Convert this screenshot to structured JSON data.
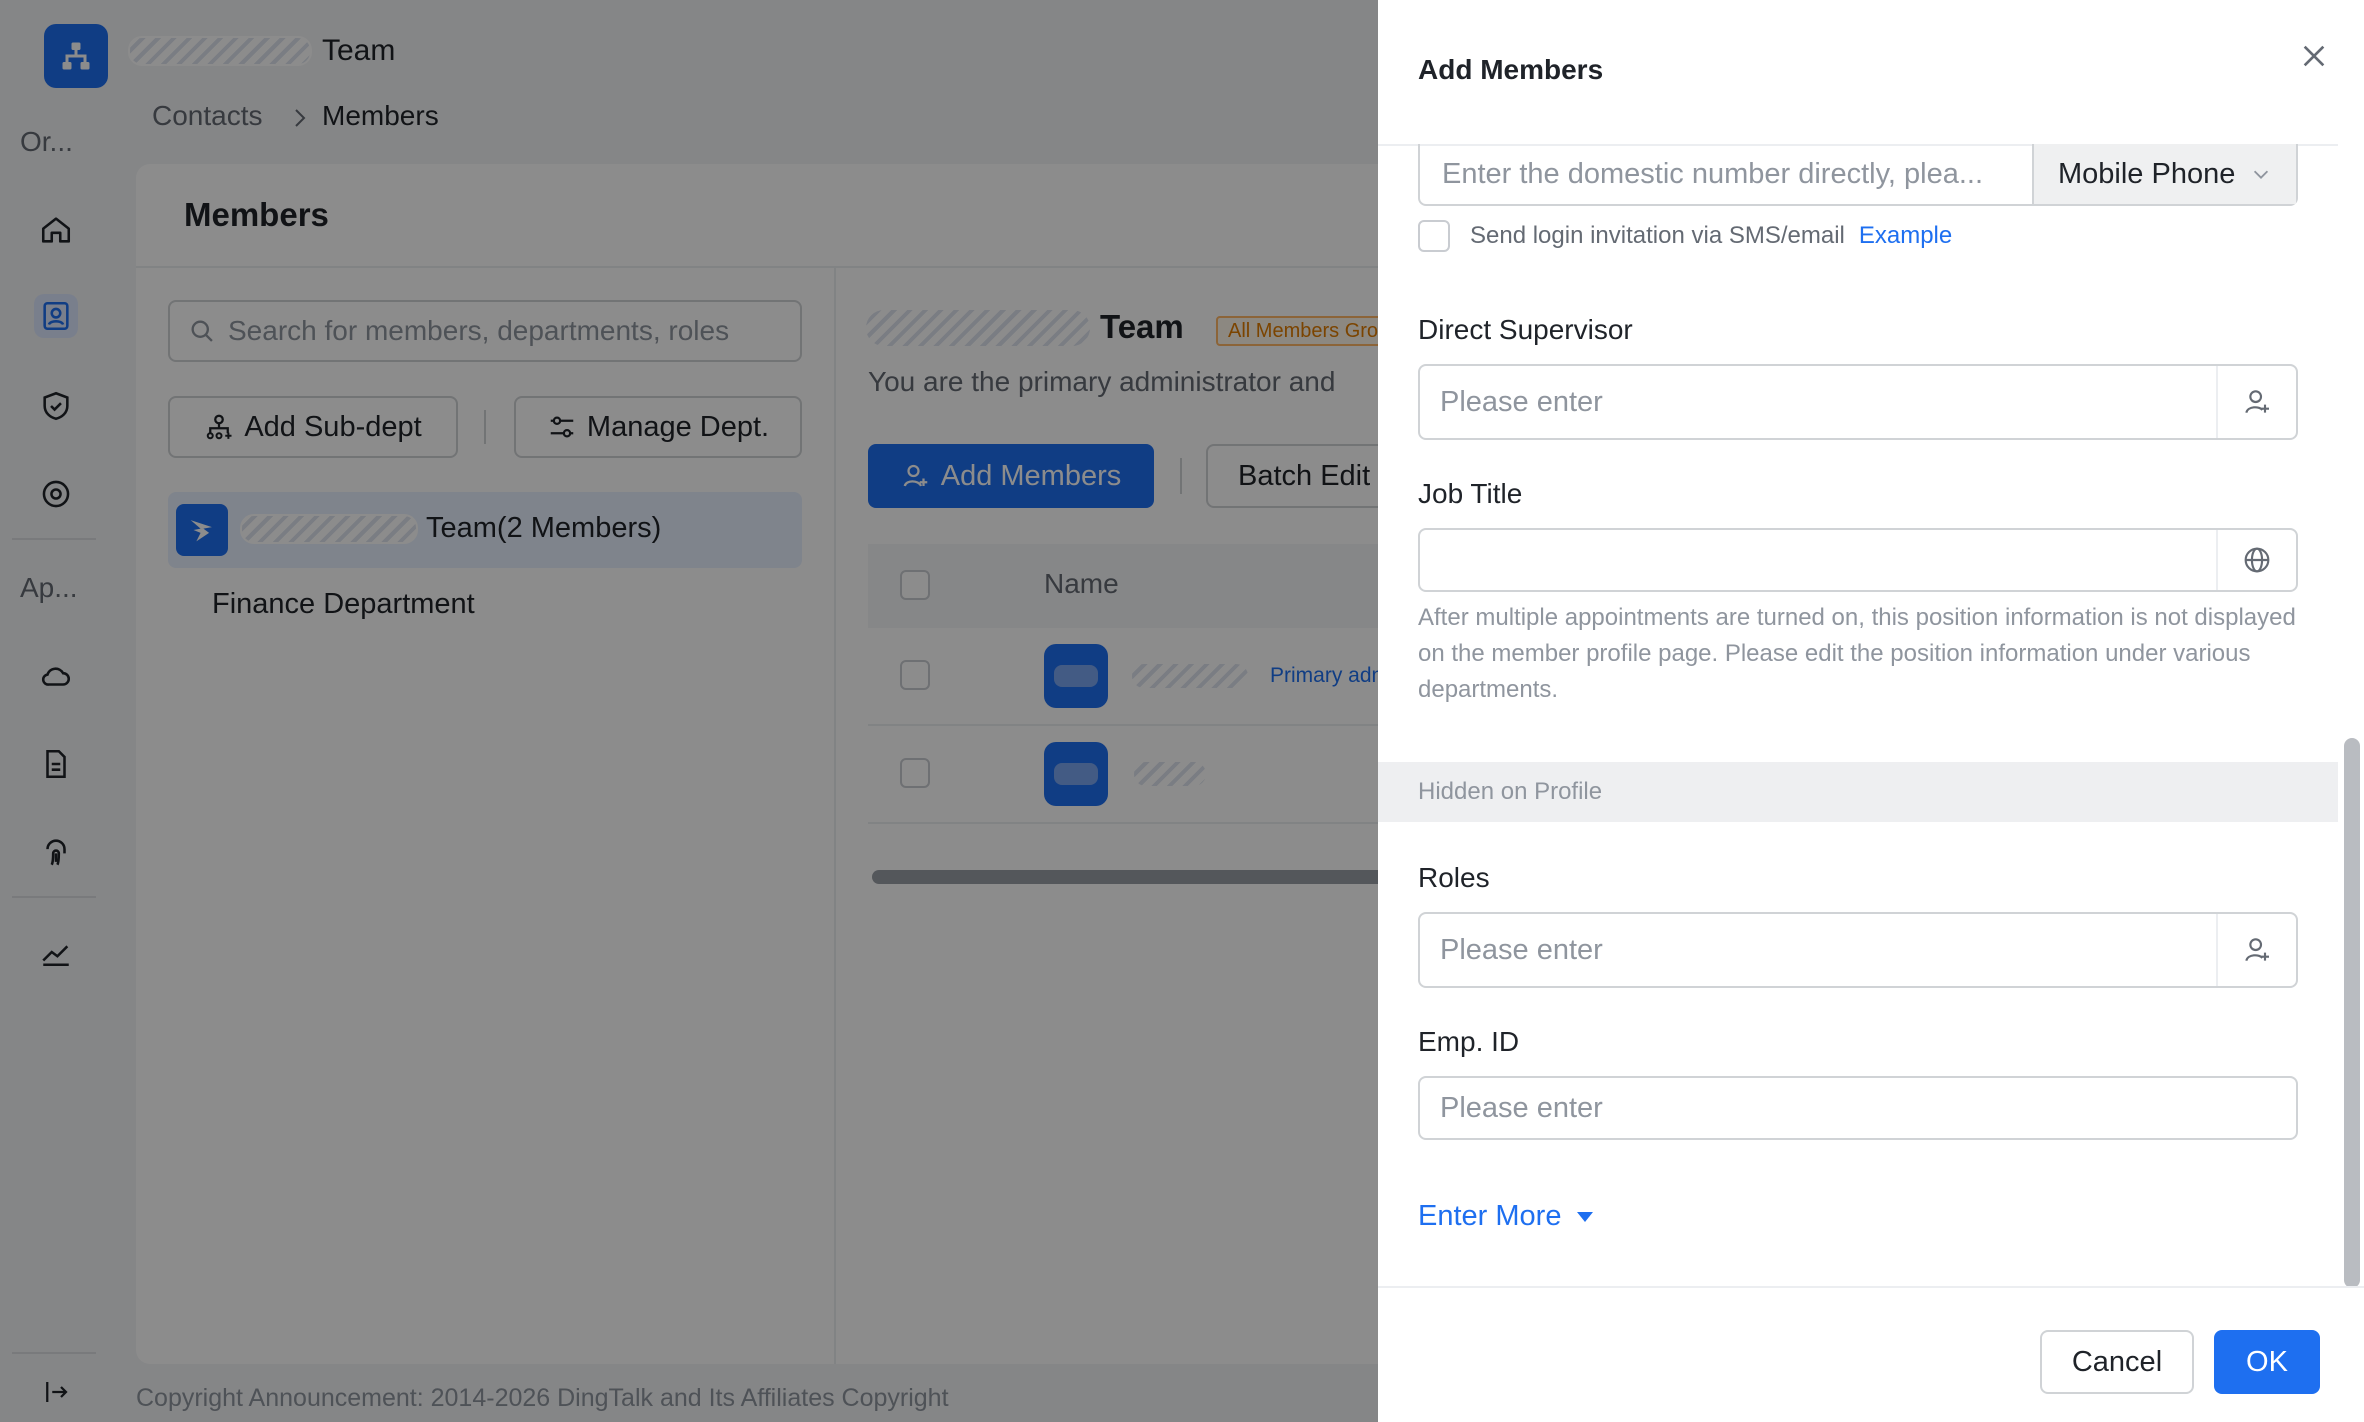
{
  "app": {
    "team_suffix": "Team",
    "breadcrumb": {
      "parent": "Contacts",
      "current": "Members"
    },
    "nav": {
      "section_org": "Or...",
      "section_apps": "Ap..."
    },
    "panel_title": "Members",
    "search_placeholder": "Search for members, departments, roles",
    "add_subdept": "Add Sub-dept",
    "manage_dept": "Manage Dept.",
    "dept_root": "Team(2 Members)",
    "dept_child": "Finance Department",
    "team_title": "Team",
    "badge": "All Members Group",
    "description": "You are the primary administrator and",
    "add_members": "Add Members",
    "batch_edit": "Batch Edit",
    "table_header_name": "Name",
    "primary_admin_tag": "Primary adm",
    "copyright": "Copyright Announcement: 2014-2026 DingTalk and Its Affiliates Copyright"
  },
  "drawer": {
    "title": "Add Members",
    "phone_placeholder": "Enter the domestic number directly, plea...",
    "phone_type": "Mobile Phone",
    "invite_text": "Send login invitation via SMS/email",
    "invite_link": "Example",
    "supervisor_label": "Direct Supervisor",
    "supervisor_placeholder": "Please enter",
    "job_title_label": "Job Title",
    "job_title_value": "",
    "job_help": "After multiple appointments are turned on, this position information is not displayed on the member profile page. Please edit the position information under various departments.",
    "hidden_section": "Hidden on Profile",
    "roles_label": "Roles",
    "roles_placeholder": "Please enter",
    "empid_label": "Emp. ID",
    "empid_placeholder": "Please enter",
    "enter_more": "Enter More",
    "cancel": "Cancel",
    "ok": "OK"
  },
  "colors": {
    "accent": "#1e6ff0",
    "mask": "rgba(0,0,0,0.45)"
  }
}
